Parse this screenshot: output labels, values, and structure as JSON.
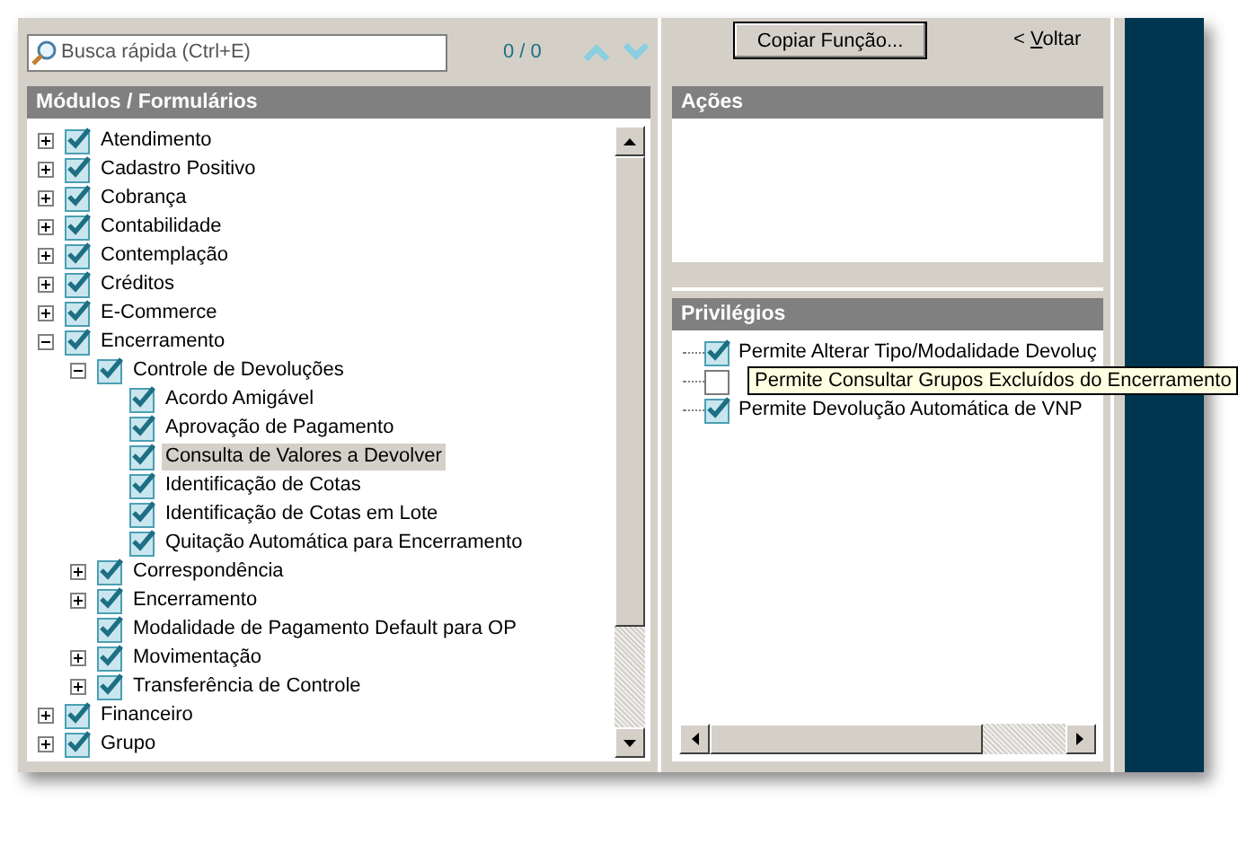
{
  "search": {
    "placeholder": "Busca rápida (Ctrl+E)",
    "counter": "0 / 0"
  },
  "copy_button": "Copiar Função...",
  "back_link": {
    "prefix": "< ",
    "access_key": "V",
    "rest": "oltar"
  },
  "modules": {
    "title": "Módulos / Formulários",
    "items": [
      {
        "label": "Atendimento",
        "kind": "folder",
        "expanded": false,
        "checked": true,
        "selected": false
      },
      {
        "label": "Cadastro Positivo",
        "kind": "folder",
        "expanded": false,
        "checked": true,
        "selected": false
      },
      {
        "label": "Cobrança",
        "kind": "folder",
        "expanded": false,
        "checked": true,
        "selected": false
      },
      {
        "label": "Contabilidade",
        "kind": "folder",
        "expanded": false,
        "checked": true,
        "selected": false
      },
      {
        "label": "Contemplação",
        "kind": "folder",
        "expanded": false,
        "checked": true,
        "selected": false
      },
      {
        "label": "Créditos",
        "kind": "folder",
        "expanded": false,
        "checked": true,
        "selected": false
      },
      {
        "label": "E-Commerce",
        "kind": "folder",
        "expanded": false,
        "checked": true,
        "selected": false
      },
      {
        "label": "Encerramento",
        "kind": "folder",
        "expanded": true,
        "checked": true,
        "selected": false,
        "children": [
          {
            "label": "Controle de Devoluções",
            "kind": "folder",
            "expanded": true,
            "checked": true,
            "selected": false,
            "children": [
              {
                "label": "Acordo Amigável",
                "kind": "leaf",
                "checked": true,
                "selected": false
              },
              {
                "label": "Aprovação de Pagamento",
                "kind": "leaf",
                "checked": true,
                "selected": false
              },
              {
                "label": "Consulta de Valores a Devolver",
                "kind": "leaf",
                "checked": true,
                "selected": true
              },
              {
                "label": "Identificação de Cotas",
                "kind": "leaf",
                "checked": true,
                "selected": false
              },
              {
                "label": "Identificação de Cotas em Lote",
                "kind": "leaf",
                "checked": true,
                "selected": false
              },
              {
                "label": "Quitação Automática para Encerramento",
                "kind": "leaf",
                "checked": true,
                "selected": false
              }
            ]
          },
          {
            "label": "Correspondência",
            "kind": "folder",
            "expanded": false,
            "checked": true,
            "selected": false
          },
          {
            "label": "Encerramento",
            "kind": "folder",
            "expanded": false,
            "checked": true,
            "selected": false
          },
          {
            "label": "Modalidade de Pagamento Default para OP",
            "kind": "leaf",
            "checked": true,
            "selected": false
          },
          {
            "label": "Movimentação",
            "kind": "folder",
            "expanded": false,
            "checked": true,
            "selected": false
          },
          {
            "label": "Transferência de Controle",
            "kind": "folder",
            "expanded": false,
            "checked": true,
            "selected": false
          }
        ]
      },
      {
        "label": "Financeiro",
        "kind": "folder",
        "expanded": false,
        "checked": true,
        "selected": false
      },
      {
        "label": "Grupo",
        "kind": "folder",
        "expanded": false,
        "checked": true,
        "selected": false
      }
    ]
  },
  "actions": {
    "title": "Ações"
  },
  "privileges": {
    "title": "Privilégios",
    "items": [
      {
        "label": "Permite Alterar Tipo/Modalidade Devoluç",
        "checked": true
      },
      {
        "checked": false
      },
      {
        "label": "Permite Devolução Automática de VNP",
        "checked": true
      }
    ]
  },
  "tooltip": {
    "text": "Permite Consultar Grupos Excluídos do Encerramento"
  }
}
